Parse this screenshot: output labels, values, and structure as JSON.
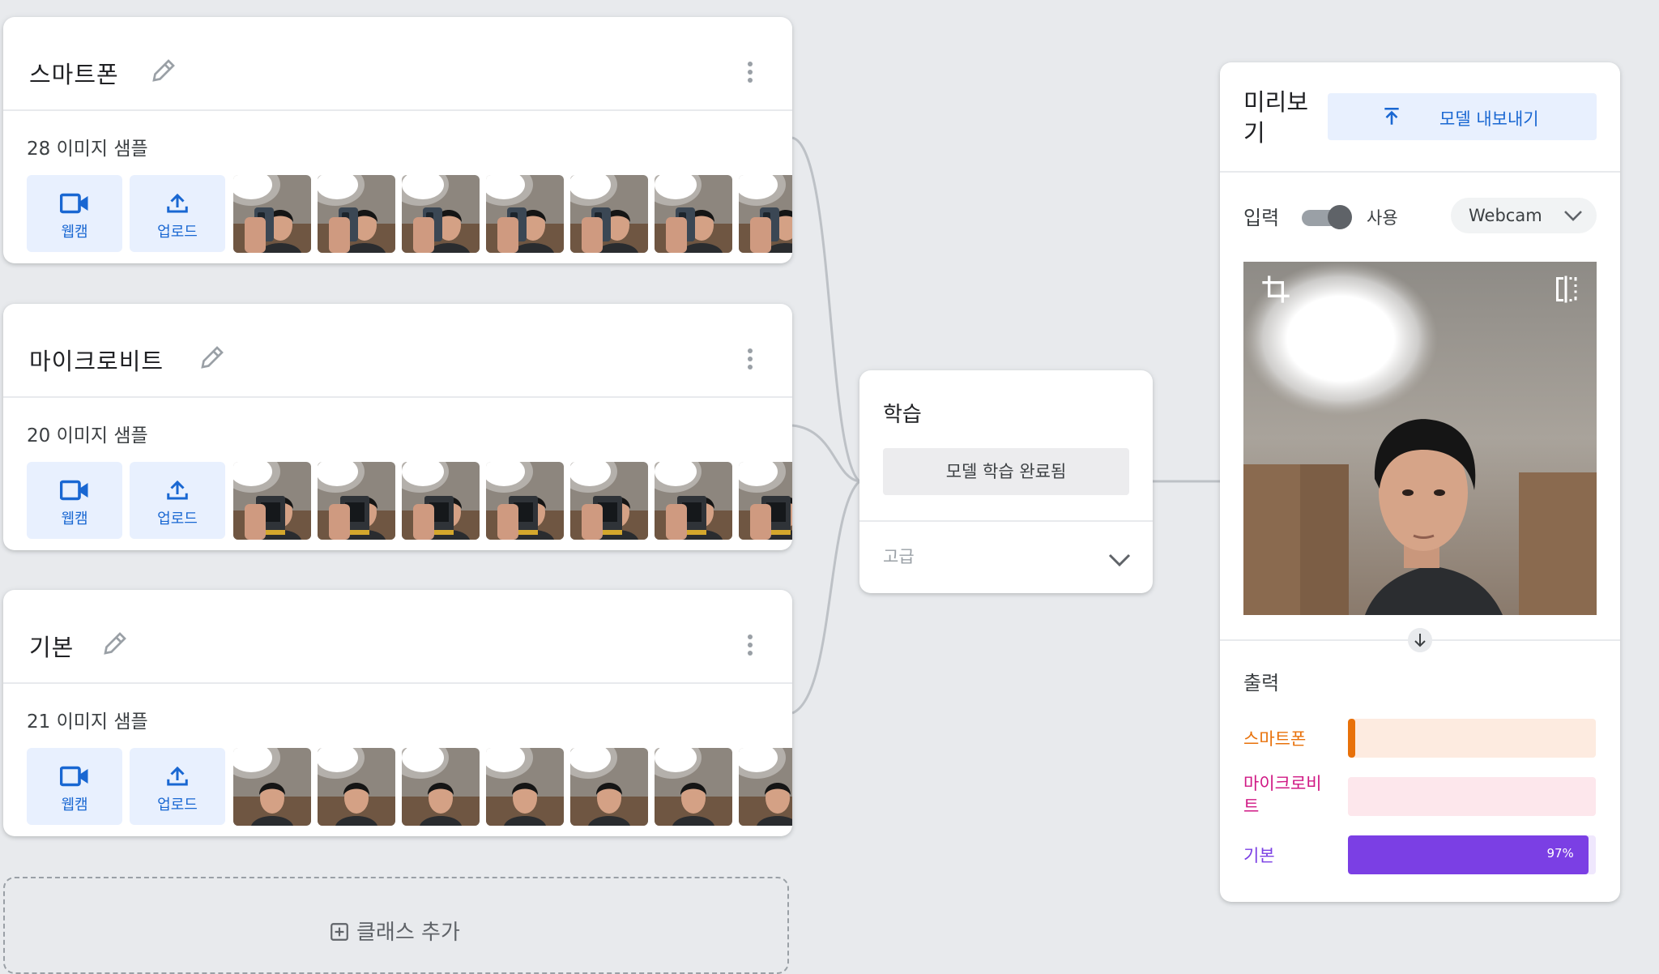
{
  "classes": [
    {
      "name": "스마트폰",
      "sample_count": "28 이미지 샘플",
      "webcam_label": "웹캠",
      "upload_label": "업로드",
      "thumb_kind": "phone"
    },
    {
      "name": "마이크로비트",
      "sample_count": "20 이미지 샘플",
      "webcam_label": "웹캠",
      "upload_label": "업로드",
      "thumb_kind": "microbit"
    },
    {
      "name": "기본",
      "sample_count": "21 이미지 샘플",
      "webcam_label": "웹캠",
      "upload_label": "업로드",
      "thumb_kind": "face"
    }
  ],
  "add_class": {
    "label": "클래스 추가"
  },
  "training": {
    "title": "학습",
    "button_label": "모델 학습 완료됨",
    "advanced_label": "고급"
  },
  "preview": {
    "title": "미리보기",
    "export_label": "모델 내보내기",
    "input_label": "입력",
    "toggle_label": "사용",
    "toggle_on": true,
    "source": "Webcam",
    "output_label": "출력",
    "outputs": [
      {
        "name": "스마트폰",
        "color": "#e8710a",
        "bg": "#fdebe0",
        "value": 0.01,
        "pct_label": ""
      },
      {
        "name": "마이크로비트",
        "color": "#d01884",
        "bg": "#fde7ec",
        "value": 0.0,
        "pct_label": ""
      },
      {
        "name": "기본",
        "color": "#7b3fe4",
        "bg": "#efe7fd",
        "value": 0.97,
        "pct_label": "97%"
      }
    ]
  },
  "colors": {
    "accent_blue": "#1967d2",
    "accent_blue_bg": "#e8f0fe",
    "page_bg": "#e8eaed"
  }
}
